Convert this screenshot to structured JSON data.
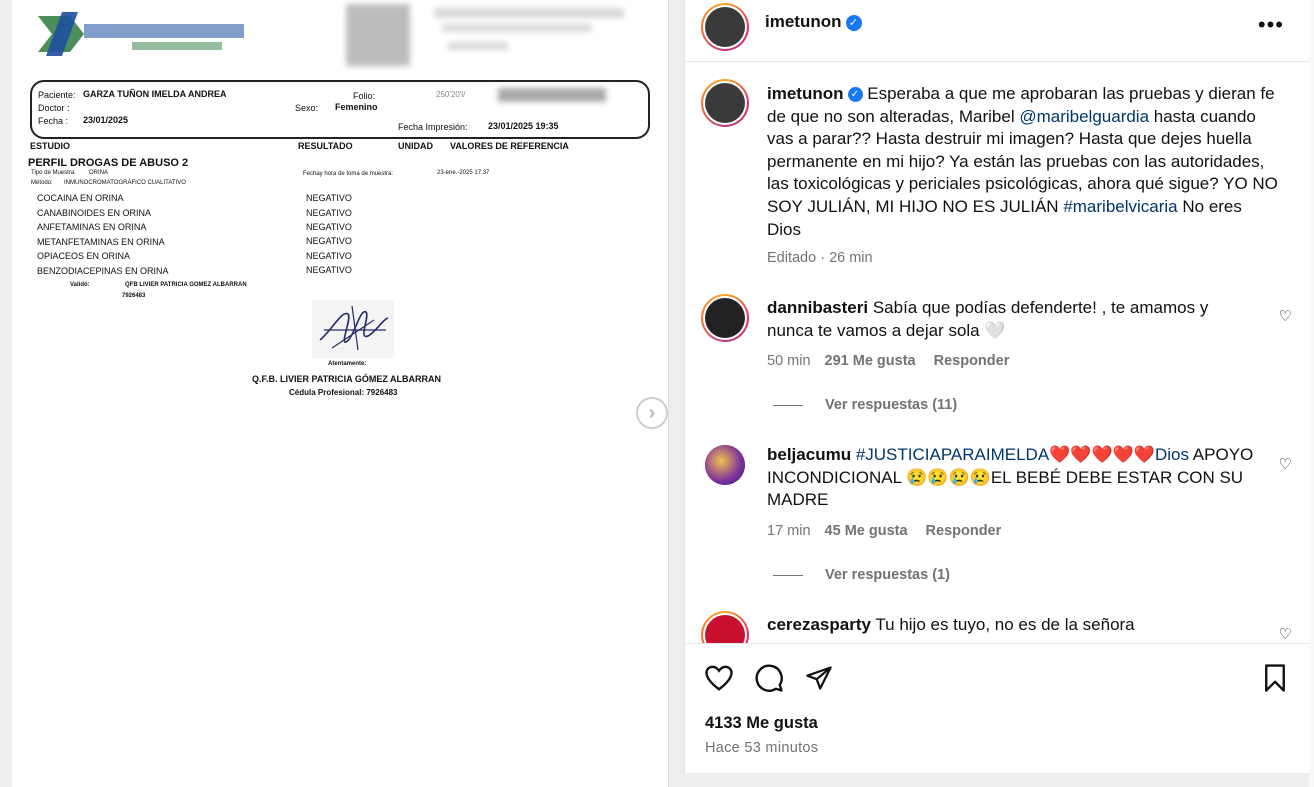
{
  "document": {
    "patient_label": "Paciente:",
    "patient_name": "GARZA TUÑON IMELDA ANDREA",
    "doctor_label": "Doctor :",
    "date_label": "Fecha :",
    "date_value": "23/01/2025",
    "folio_label": "Folio:",
    "folio_value": "250'20'l/",
    "sex_label": "Sexo:",
    "sex_value": "Femenino",
    "print_label": "Fecha Impresión:",
    "print_value": "23/01/2025  19:35",
    "columns": [
      "ESTUDIO",
      "RESULTADO",
      "UNIDAD",
      "VALORES DE REFERENCIA"
    ],
    "profile": "PERFIL DROGAS DE ABUSO  2",
    "sample_type_label": "Tipo de Muestra:",
    "sample_type_value": "ORINA",
    "method_label": "Método:",
    "method_value": "INMUNOCROMATOGRÁFICO CUALITATIVO",
    "sample_time_label": "Fechay hora de toma de muestra:",
    "sample_time_value": "23-ene.-2025  17:37",
    "tests": [
      {
        "name": "COCAINA EN ORINA",
        "result": "NEGATIVO"
      },
      {
        "name": "CANABINOIDES EN ORINA",
        "result": "NEGATIVO"
      },
      {
        "name": "ANFETAMINAS EN ORINA",
        "result": "NEGATIVO"
      },
      {
        "name": "METANFETAMINAS EN ORINA",
        "result": "NEGATIVO"
      },
      {
        "name": "OPIACEOS EN ORINA",
        "result": "NEGATIVO"
      },
      {
        "name": "BENZODIACEPINAS EN ORINA",
        "result": "NEGATIVO"
      }
    ],
    "validated_label": "Validó:",
    "validated_by": "QFB LIVIER PATRICIA GOMEZ ALBARRAN",
    "validated_id": "7926483",
    "sign_label": "Atentamente:",
    "signer": "Q.F.B. LIVIER PATRICIA GÓMEZ ALBARRAN",
    "cedula": "Cédula Profesional: 7926483"
  },
  "post": {
    "author": "imetunon",
    "caption_user": "imetunon",
    "caption_part1": "Esperaba a que me aprobaran las pruebas y dieran fe de que no son alteradas, Maribel ",
    "caption_mention": "@maribelguardia",
    "caption_part2": " hasta cuando vas a parar?? Hasta destruir mi imagen? Hasta que dejes huella permanente en mi hijo? Ya están las pruebas con las autoridades, las toxicológicas y periciales psicológicas, ahora qué sigue? YO NO SOY JULIÁN, MI HIJO NO ES JULIÁN ",
    "caption_tag": "#maribelvicaria",
    "caption_part3": " No eres Dios",
    "caption_meta": "Editado · 26 min",
    "likes": "4133 Me gusta",
    "time_ago": "Hace 53 minutos"
  },
  "comments": [
    {
      "user": "dannibasteri",
      "text": "Sabía que podías defenderte! , te amamos y nunca te vamos a dejar sola 🤍",
      "time": "50 min",
      "likes": "291 Me gusta",
      "reply": "Responder",
      "replies": "Ver respuestas (11)"
    },
    {
      "user": "beljacumu",
      "tag": "#JUSTICIAPARAIMELDA❤️❤️❤️❤️❤️Dios",
      "text": " APOYO INCONDICIONAL 😢😢😢😢EL BEBÉ DEBE ESTAR CON SU MADRE",
      "time": "17 min",
      "likes": "45 Me gusta",
      "reply": "Responder",
      "replies": "Ver respuestas (1)"
    },
    {
      "user": "cerezasparty",
      "text": "Tu hijo es tuyo, no es de la señora"
    }
  ],
  "icons": {
    "more": "•••",
    "heart": "♡",
    "next": "›"
  },
  "colors": {
    "link": "#00376b",
    "verified": "#1877f2",
    "muted": "#737373"
  }
}
